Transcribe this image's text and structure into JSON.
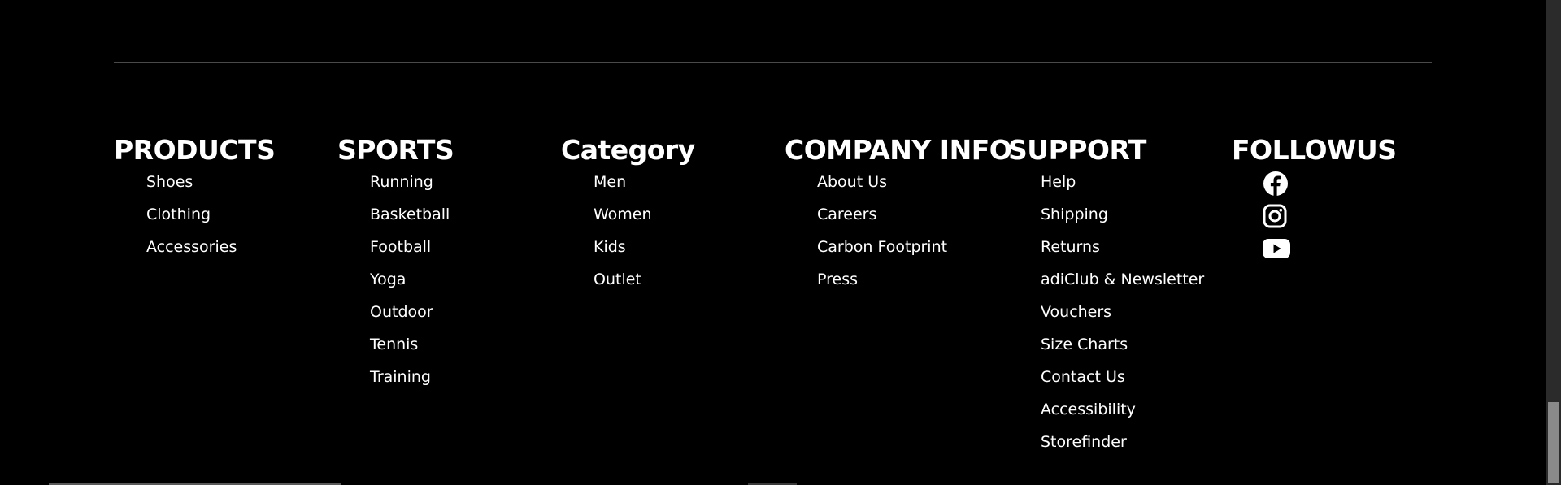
{
  "colors": {
    "background": "#000000",
    "text": "#ffffff",
    "divider": "#4a4a4a"
  },
  "footer": {
    "columns": [
      {
        "title": "PRODUCTS",
        "items": [
          "Shoes",
          "Clothing",
          "Accessories"
        ]
      },
      {
        "title": "SPORTS",
        "items": [
          "Running",
          "Basketball",
          "Football",
          "Yoga",
          "Outdoor",
          "Tennis",
          "Training"
        ]
      },
      {
        "title": "Category",
        "items": [
          "Men",
          "Women",
          "Kids",
          "Outlet"
        ]
      },
      {
        "title": "COMPANY INFO",
        "items": [
          "About Us",
          "Careers",
          "Carbon Footprint",
          "Press"
        ]
      },
      {
        "title": "SUPPORT",
        "items": [
          "Help",
          "Shipping",
          "Returns",
          "adiClub & Newsletter",
          "Vouchers",
          "Size Charts",
          "Contact Us",
          "Accessibility",
          "Storefinder"
        ]
      }
    ],
    "follow": {
      "title": "FOLLOWUS",
      "icons": [
        "facebook-icon",
        "instagram-icon",
        "youtube-icon"
      ]
    }
  }
}
